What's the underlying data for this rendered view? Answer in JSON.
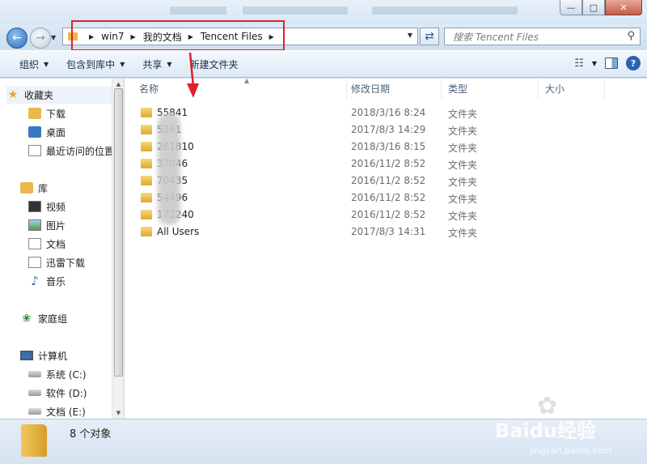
{
  "address": {
    "crumbs": [
      "win7",
      "我的文档",
      "Tencent Files"
    ]
  },
  "search": {
    "placeholder": "搜索 Tencent Files"
  },
  "toolbar": {
    "organize": "组织",
    "include_in_library": "包含到库中",
    "share": "共享",
    "new_folder": "新建文件夹"
  },
  "nav": {
    "favorites": "收藏夹",
    "downloads": "下载",
    "desktop": "桌面",
    "recent": "最近访问的位置",
    "libraries": "库",
    "videos": "视频",
    "pictures": "图片",
    "documents": "文档",
    "xunlei": "迅雷下载",
    "music": "音乐",
    "homegroup": "家庭组",
    "computer": "计算机",
    "drive_c": "系统 (C:)",
    "drive_d": "软件 (D:)",
    "drive_e": "文档 (E:)"
  },
  "columns": {
    "name": "名称",
    "modified": "修改日期",
    "type": "类型",
    "size": "大小"
  },
  "files": [
    {
      "name": "55841",
      "modified": "2018/3/16 8:24",
      "type": "文件夹"
    },
    {
      "name": "5261",
      "modified": "2017/8/3 14:29",
      "type": "文件夹"
    },
    {
      "name": "261810",
      "modified": "2018/3/16 8:15",
      "type": "文件夹"
    },
    {
      "name": "37046",
      "modified": "2016/11/2 8:52",
      "type": "文件夹"
    },
    {
      "name": "70435",
      "modified": "2016/11/2 8:52",
      "type": "文件夹"
    },
    {
      "name": "54496",
      "modified": "2016/11/2 8:52",
      "type": "文件夹"
    },
    {
      "name": "172240",
      "modified": "2016/11/2 8:52",
      "type": "文件夹"
    },
    {
      "name": "All Users",
      "modified": "2017/8/3 14:31",
      "type": "文件夹"
    }
  ],
  "status": {
    "count": "8 个对象"
  },
  "watermark": {
    "logo": "Baidu经验",
    "url": "jingyan.baidu.com"
  },
  "colors": {
    "highlight_box": "#e0202a",
    "arrow": "#e0202a"
  }
}
